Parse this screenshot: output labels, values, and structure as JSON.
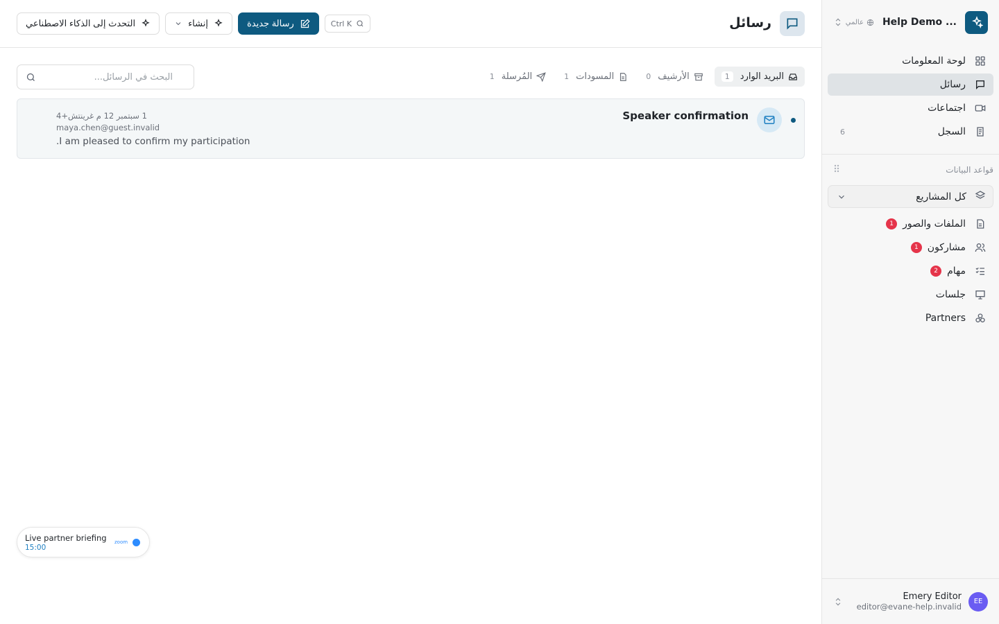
{
  "workspace": {
    "name": "Help Demo ...",
    "scope": "عالمي"
  },
  "sidebar": {
    "nav": [
      {
        "label": "لوحة المعلومات",
        "icon": "dashboard-icon"
      },
      {
        "label": "رسائل",
        "icon": "message-icon",
        "active": true
      },
      {
        "label": "اجتماعات",
        "icon": "video-icon"
      },
      {
        "label": "السجل",
        "icon": "log-icon",
        "count": "6"
      }
    ],
    "databases_title": "قواعد البيانات",
    "project_select": "كل المشاريع",
    "databases": [
      {
        "label": "الملفات والصور",
        "icon": "file-icon",
        "badge": "1"
      },
      {
        "label": "مشاركون",
        "icon": "users-icon",
        "badge": "1"
      },
      {
        "label": "مهام",
        "icon": "tasks-icon",
        "badge": "2"
      },
      {
        "label": "جلسات",
        "icon": "presentation-icon"
      },
      {
        "label": "Partners",
        "icon": "partners-icon"
      }
    ],
    "user": {
      "initials": "EE",
      "name": "Emery Editor",
      "email": "editor@evane-help.invalid"
    }
  },
  "header": {
    "title": "رسائل",
    "shortcut": "Ctrl K",
    "new_message": "رسالة جديدة",
    "create": "إنشاء",
    "ai_chat": "التحدث إلى الذكاء الاصطناعي"
  },
  "tabs": [
    {
      "label": "البريد الوارد",
      "count": "1",
      "icon": "inbox-icon",
      "active": true
    },
    {
      "label": "الأرشيف",
      "count": "0",
      "icon": "archive-icon"
    },
    {
      "label": "المسودات",
      "count": "1",
      "icon": "draft-icon"
    },
    {
      "label": "المُرسلة",
      "count": "1",
      "icon": "send-icon"
    }
  ],
  "search": {
    "placeholder": "البحث في الرسائل..."
  },
  "messages": [
    {
      "subject": "Speaker confirmation",
      "date": "1 سبتمبر 12 م غرينتش+4",
      "from": "maya.chen@guest.invalid",
      "preview": "I am pleased to confirm my participation."
    }
  ],
  "meeting": {
    "title": "Live partner briefing",
    "time": "15:00",
    "provider": "zoom"
  },
  "colors": {
    "brand": "#0e5a80",
    "badge": "#e5344a",
    "avatar": "#6a5cf2",
    "link": "#1d7fc1"
  }
}
